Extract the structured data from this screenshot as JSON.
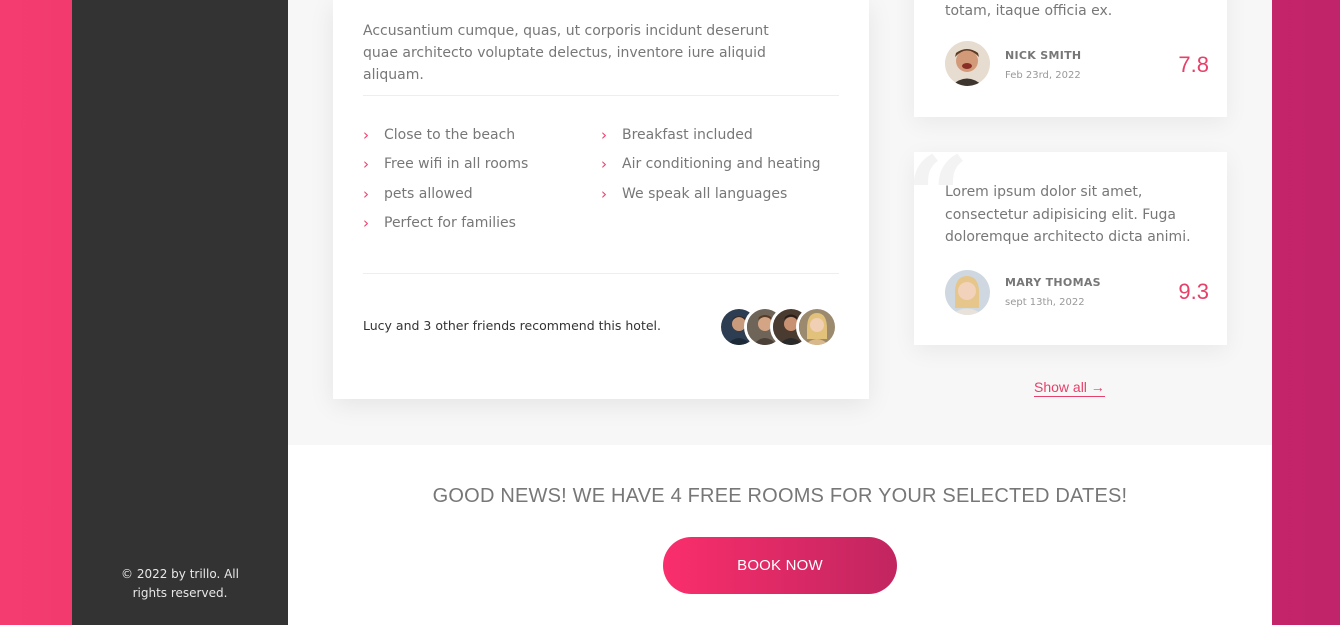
{
  "sidebar": {
    "legal": "© 2022 by trillo. All rights reserved."
  },
  "description": {
    "text": "Accusantium cumque, quas, ut corporis incidunt deserunt quae architecto voluptate delectus, inventore iure aliquid aliquam.",
    "features": [
      "Close to the beach",
      "Breakfast included",
      "Free wifi in all rooms",
      "Air conditioning and heating",
      "pets allowed",
      "We speak all languages",
      "Perfect for families"
    ],
    "recommend": "Lucy and 3 other friends recommend this hotel."
  },
  "reviews": [
    {
      "text": "totam, itaque officia ex.",
      "name": "Nick Smith",
      "date": "Feb 23rd, 2022",
      "rating": "7.8"
    },
    {
      "text": "Lorem ipsum dolor sit amet, consectetur adipisicing elit. Fuga doloremque architecto dicta animi.",
      "name": "Mary Thomas",
      "date": "sept 13th, 2022",
      "rating": "9.3"
    }
  ],
  "show_all": "Show all →",
  "cta": {
    "title": "GOOD NEWS! WE HAVE 4 FREE ROOMS FOR YOUR SELECTED DATES!",
    "button": "BOOK NOW"
  },
  "colors": {
    "accent": "#e5416a",
    "sidebar": "#333333",
    "gradient_start": "#fa2e6c",
    "gradient_end": "#c12560"
  }
}
